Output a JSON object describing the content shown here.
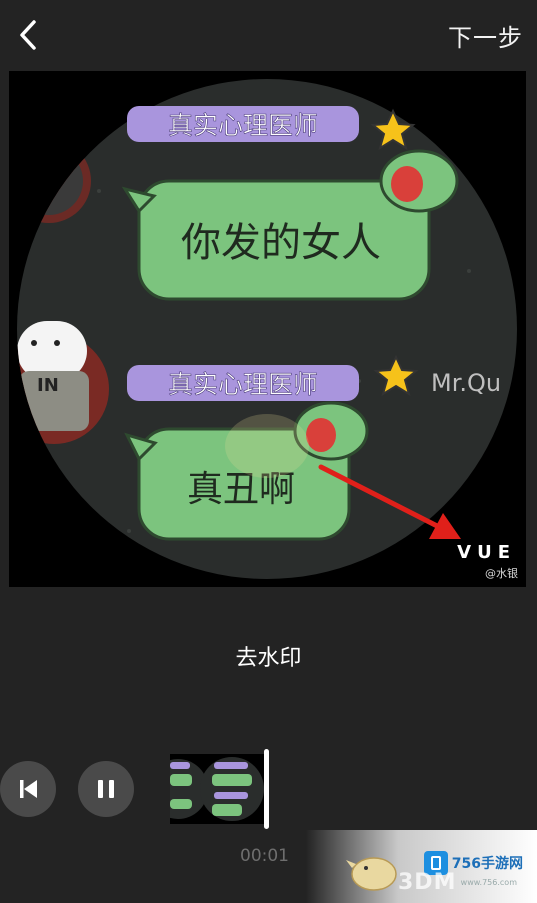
{
  "header": {
    "back_icon": "chevron-left-icon",
    "next_label": "下一步"
  },
  "preview": {
    "badge_text": "真实心理医师",
    "bubble_1": "你发的女人",
    "bubble_2": "真丑啊",
    "side_text": "Mr.Qu",
    "shirt_text": "IN",
    "watermark_brand": "VUE",
    "watermark_handle": "@水银",
    "colors": {
      "bubble_green": "#7cc47e",
      "badge_purple": "#a995dd",
      "arrow_red": "#e0201a",
      "star_yellow": "#f6c21a"
    }
  },
  "actions": {
    "remove_watermark_label": "去水印"
  },
  "player": {
    "prev_icon": "skip-previous-icon",
    "pause_icon": "pause-icon",
    "time_label": "00:01"
  },
  "overlay": {
    "site_name": "756手游网",
    "site_brand": "3DM",
    "site_url": "www.756.com"
  }
}
